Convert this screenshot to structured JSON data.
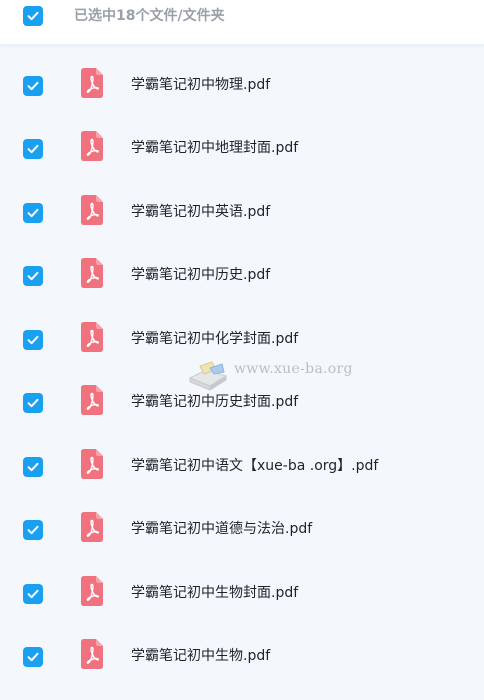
{
  "header": {
    "title": "已选中18个文件/文件夹",
    "select_all_checked": true
  },
  "files": [
    {
      "name": "",
      "checked": true,
      "icon": "pdf-icon"
    },
    {
      "name": "学霸笔记初中物理.pdf",
      "checked": true,
      "icon": "pdf-icon"
    },
    {
      "name": "学霸笔记初中地理封面.pdf",
      "checked": true,
      "icon": "pdf-icon"
    },
    {
      "name": "学霸笔记初中英语.pdf",
      "checked": true,
      "icon": "pdf-icon"
    },
    {
      "name": "学霸笔记初中历史.pdf",
      "checked": true,
      "icon": "pdf-icon"
    },
    {
      "name": "学霸笔记初中化学封面.pdf",
      "checked": true,
      "icon": "pdf-icon"
    },
    {
      "name": "学霸笔记初中历史封面.pdf",
      "checked": true,
      "icon": "pdf-icon"
    },
    {
      "name": "学霸笔记初中语文【xue-ba .org】.pdf",
      "checked": true,
      "icon": "pdf-icon"
    },
    {
      "name": "学霸笔记初中道德与法治.pdf",
      "checked": true,
      "icon": "pdf-icon"
    },
    {
      "name": "学霸笔记初中生物封面.pdf",
      "checked": true,
      "icon": "pdf-icon"
    },
    {
      "name": "学霸笔记初中生物.pdf",
      "checked": true,
      "icon": "pdf-icon"
    }
  ],
  "watermark": {
    "text": "www.xue-ba.org"
  },
  "colors": {
    "checkbox": "#1aa0f0",
    "pdf_icon": "#f0727e",
    "background": "#f4f8fd",
    "header_text": "#9aa0a8"
  }
}
